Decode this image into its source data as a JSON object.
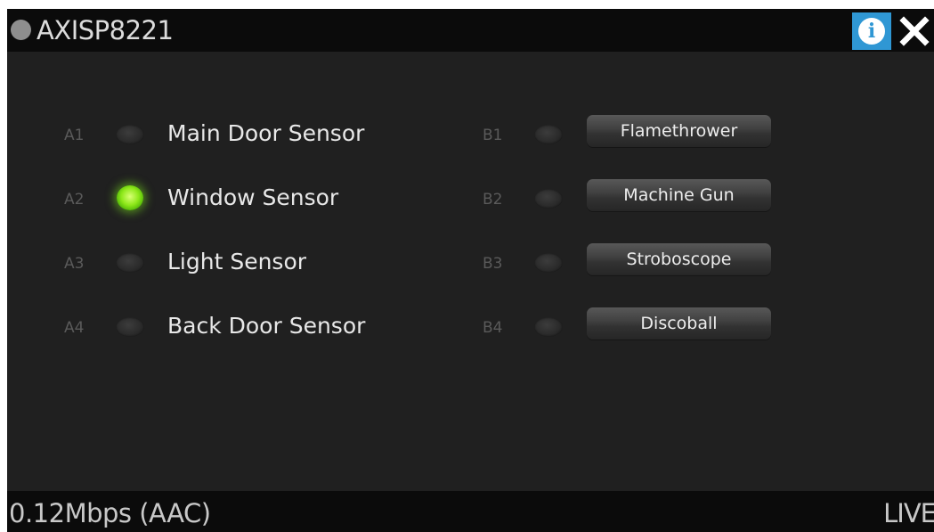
{
  "header": {
    "title": "AXISP8221",
    "status_icon": "status-dot-icon",
    "info_icon": "info-icon",
    "close_icon": "close-icon",
    "info_color": "#2f97d4"
  },
  "inputs": [
    {
      "port": "A1",
      "name": "Main Door Sensor",
      "active": false
    },
    {
      "port": "A2",
      "name": "Window Sensor",
      "active": true
    },
    {
      "port": "A3",
      "name": "Light Sensor",
      "active": false
    },
    {
      "port": "A4",
      "name": "Back Door Sensor",
      "active": false
    }
  ],
  "outputs": [
    {
      "port": "B1",
      "name": "Flamethrower",
      "active": false
    },
    {
      "port": "B2",
      "name": "Machine Gun",
      "active": false
    },
    {
      "port": "B3",
      "name": "Stroboscope",
      "active": false
    },
    {
      "port": "B4",
      "name": "Discoball",
      "active": false
    }
  ],
  "footer": {
    "bitrate": "0.12Mbps (AAC)",
    "mode": "LIVE"
  },
  "colors": {
    "led_on": "#8ee81a",
    "background": "#202020"
  }
}
